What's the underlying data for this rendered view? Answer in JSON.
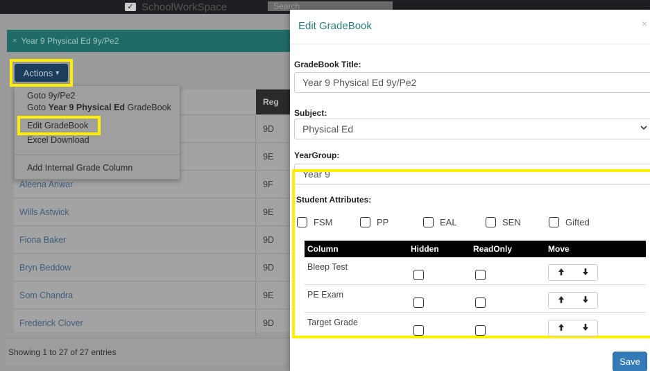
{
  "topbar": {
    "brand": "SchoolWorkSpace",
    "search_placeholder": "Search"
  },
  "breadcrumb": {
    "close_glyph": "×",
    "text": "Year 9 Physical Ed 9y/Pe2"
  },
  "actions": {
    "label": "Actions",
    "caret": "▾"
  },
  "dropdown": {
    "goto_class": "Goto 9y/Pe2",
    "goto_gradebook_prefix": "Goto ",
    "goto_gradebook_bold": "Year 9 Physical Ed",
    "goto_gradebook_suffix": " GradeBook",
    "edit": "Edit GradeBook",
    "excel": "Excel Download",
    "add_column": "Add Internal Grade Column"
  },
  "table": {
    "reg_header": "Reg",
    "rows": [
      {
        "name": "",
        "reg": "9D"
      },
      {
        "name": "",
        "reg": "9E"
      },
      {
        "name": "Aleena Anwar",
        "reg": "9F"
      },
      {
        "name": "Wills Astwick",
        "reg": "9E"
      },
      {
        "name": "Fiona Baker",
        "reg": "9D"
      },
      {
        "name": "Bryn Beddow",
        "reg": "9D"
      },
      {
        "name": "Som Chandra",
        "reg": "9E"
      },
      {
        "name": "Frederick Clover",
        "reg": "9D"
      }
    ],
    "footer": "Showing 1 to 27 of 27 entries"
  },
  "modal": {
    "title": "Edit GradeBook",
    "close_glyph": "×",
    "gradebook_title_label": "GradeBook Title:",
    "gradebook_title_value": "Year  9 Physical Ed 9y/Pe2",
    "subject_label": "Subject:",
    "subject_value": "Physical Ed",
    "yeargroup_label": "YearGroup:",
    "yeargroup_value": "Year  9",
    "attributes_label": "Student Attributes:",
    "attributes": [
      "FSM",
      "PP",
      "EAL",
      "SEN",
      "Gifted"
    ],
    "grid_headers": {
      "column": "Column",
      "hidden": "Hidden",
      "readonly": "ReadOnly",
      "move": "Move"
    },
    "grid_rows": [
      "Bleep Test",
      "PE Exam",
      "Target Grade"
    ],
    "move_up": "🠕",
    "move_down": "🠗",
    "save_label": "Save"
  }
}
